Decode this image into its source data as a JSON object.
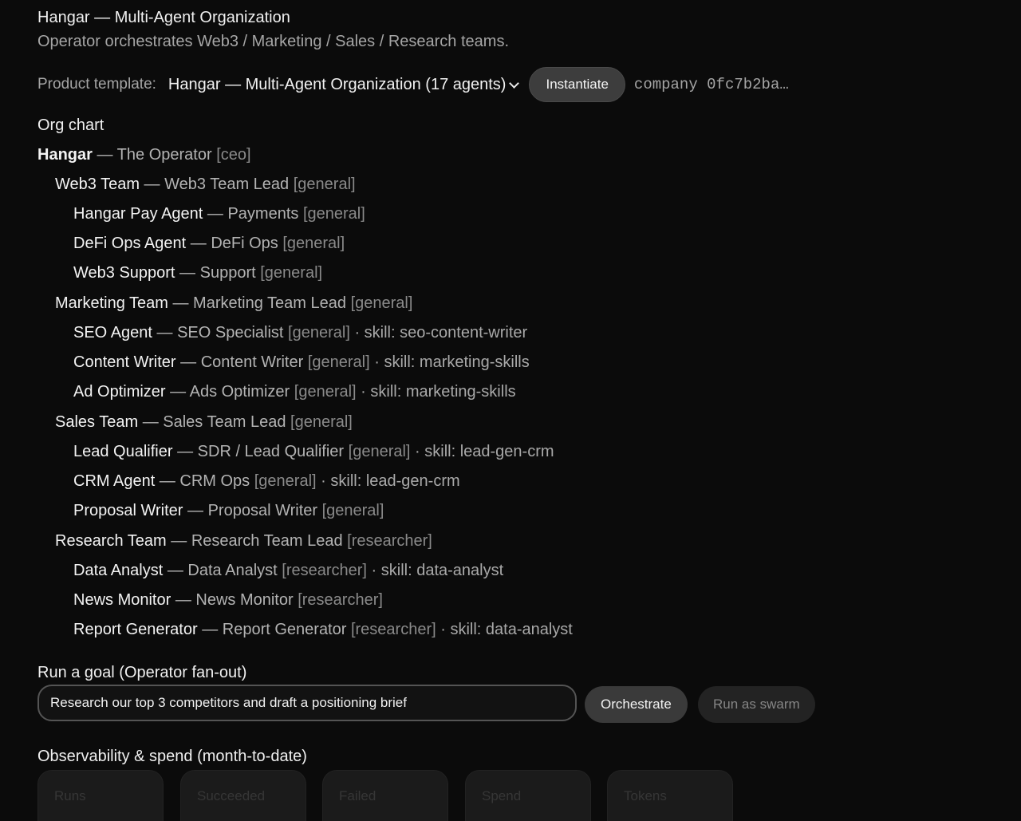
{
  "header": {
    "title": "Hangar — Multi-Agent Organization",
    "subtitle": "Operator orchestrates Web3 / Marketing / Sales / Research teams."
  },
  "template": {
    "label": "Product template:",
    "selected": "Hangar — Multi-Agent Organization (17 agents)",
    "instantiate_label": "Instantiate",
    "company_id": "company 0fc7b2ba…"
  },
  "org": {
    "heading": "Org chart",
    "nodes": [
      {
        "name": "Hangar",
        "role": "The Operator",
        "kind": "[ceo]",
        "skill": ""
      },
      {
        "name": "Web3 Team",
        "role": "Web3 Team Lead",
        "kind": "[general]",
        "skill": ""
      },
      {
        "name": "Hangar Pay Agent",
        "role": "Payments",
        "kind": "[general]",
        "skill": ""
      },
      {
        "name": "DeFi Ops Agent",
        "role": "DeFi Ops",
        "kind": "[general]",
        "skill": ""
      },
      {
        "name": "Web3 Support",
        "role": "Support",
        "kind": "[general]",
        "skill": ""
      },
      {
        "name": "Marketing Team",
        "role": "Marketing Team Lead",
        "kind": "[general]",
        "skill": ""
      },
      {
        "name": "SEO Agent",
        "role": "SEO Specialist",
        "kind": "[general]",
        "skill": "skill: seo-content-writer"
      },
      {
        "name": "Content Writer",
        "role": "Content Writer",
        "kind": "[general]",
        "skill": "skill: marketing-skills"
      },
      {
        "name": "Ad Optimizer",
        "role": "Ads Optimizer",
        "kind": "[general]",
        "skill": "skill: marketing-skills"
      },
      {
        "name": "Sales Team",
        "role": "Sales Team Lead",
        "kind": "[general]",
        "skill": ""
      },
      {
        "name": "Lead Qualifier",
        "role": "SDR / Lead Qualifier",
        "kind": "[general]",
        "skill": "skill: lead-gen-crm"
      },
      {
        "name": "CRM Agent",
        "role": "CRM Ops",
        "kind": "[general]",
        "skill": "skill: lead-gen-crm"
      },
      {
        "name": "Proposal Writer",
        "role": "Proposal Writer",
        "kind": "[general]",
        "skill": ""
      },
      {
        "name": "Research Team",
        "role": "Research Team Lead",
        "kind": "[researcher]",
        "skill": ""
      },
      {
        "name": "Data Analyst",
        "role": "Data Analyst",
        "kind": "[researcher]",
        "skill": "skill: data-analyst"
      },
      {
        "name": "News Monitor",
        "role": "News Monitor",
        "kind": "[researcher]",
        "skill": ""
      },
      {
        "name": "Report Generator",
        "role": "Report Generator",
        "kind": "[researcher]",
        "skill": "skill: data-analyst"
      }
    ]
  },
  "goal": {
    "heading": "Run a goal (Operator fan-out)",
    "value": "Research our top 3 competitors and draft a positioning brief",
    "orchestrate_label": "Orchestrate",
    "swarm_label": "Run as swarm"
  },
  "observability": {
    "heading": "Observability & spend (month-to-date)",
    "cards": [
      {
        "label": "Runs"
      },
      {
        "label": "Succeeded"
      },
      {
        "label": "Failed"
      },
      {
        "label": "Spend"
      },
      {
        "label": "Tokens"
      }
    ]
  }
}
